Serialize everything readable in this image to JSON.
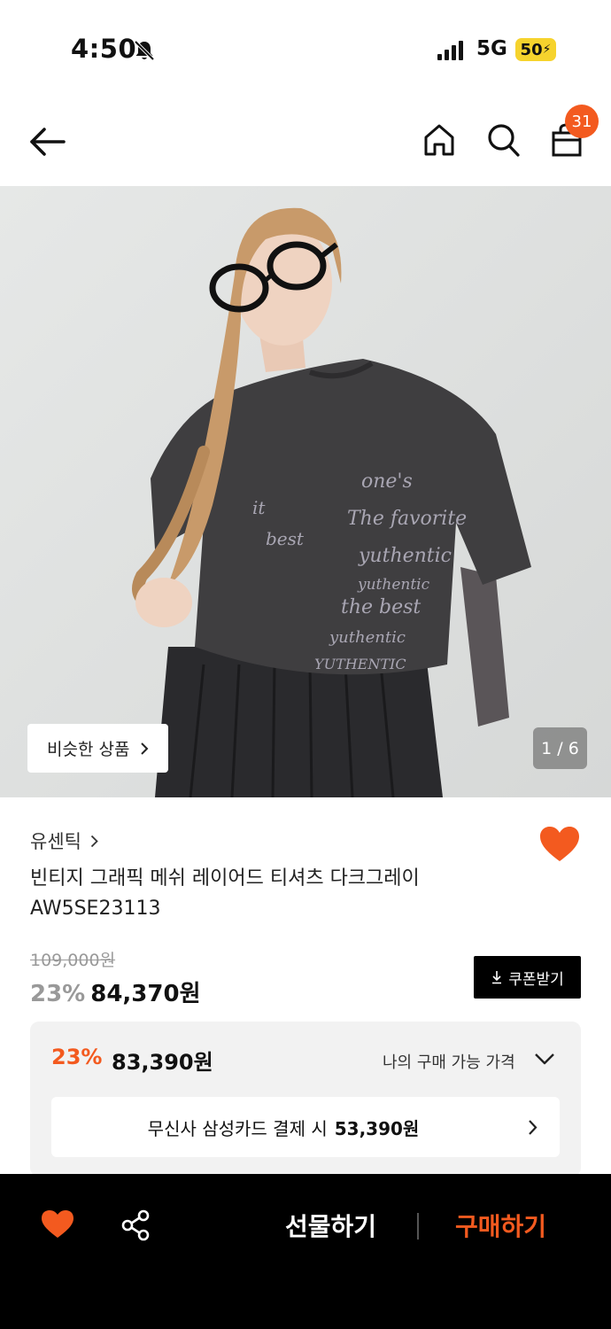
{
  "status_bar": {
    "time": "4:50",
    "network": "5G",
    "battery": "50"
  },
  "header": {
    "cart_count": "31"
  },
  "hero": {
    "similar_label": "비슷한 상품",
    "page_indicator": "1 / 6"
  },
  "product": {
    "brand": "유센틱",
    "name_line1": "빈티지 그래픽 메쉬 레이어드 티셔츠 다크그레이",
    "name_line2": "AW5SE23113",
    "original_price": "109,000원",
    "discount": "23%",
    "sale_price": "84,370원",
    "coupon_label": "쿠폰받기"
  },
  "my_price": {
    "discount": "23%",
    "price": "83,390원",
    "label": "나의 구매 가능 가격",
    "card_offer_text": "무신사 삼성카드 결제 시",
    "card_offer_price": "53,390원"
  },
  "bottom_bar": {
    "gift_label": "선물하기",
    "buy_label": "구매하기"
  },
  "colors": {
    "accent": "#f35a1f",
    "battery": "#f6d32d",
    "dark": "#000000"
  },
  "icons": [
    "bell-slash-icon",
    "signal-icon",
    "back-arrow-icon",
    "home-icon",
    "search-icon",
    "shopping-bag-icon",
    "heart-icon",
    "chevron-down-icon",
    "chevron-right-icon",
    "download-icon",
    "share-icon"
  ]
}
